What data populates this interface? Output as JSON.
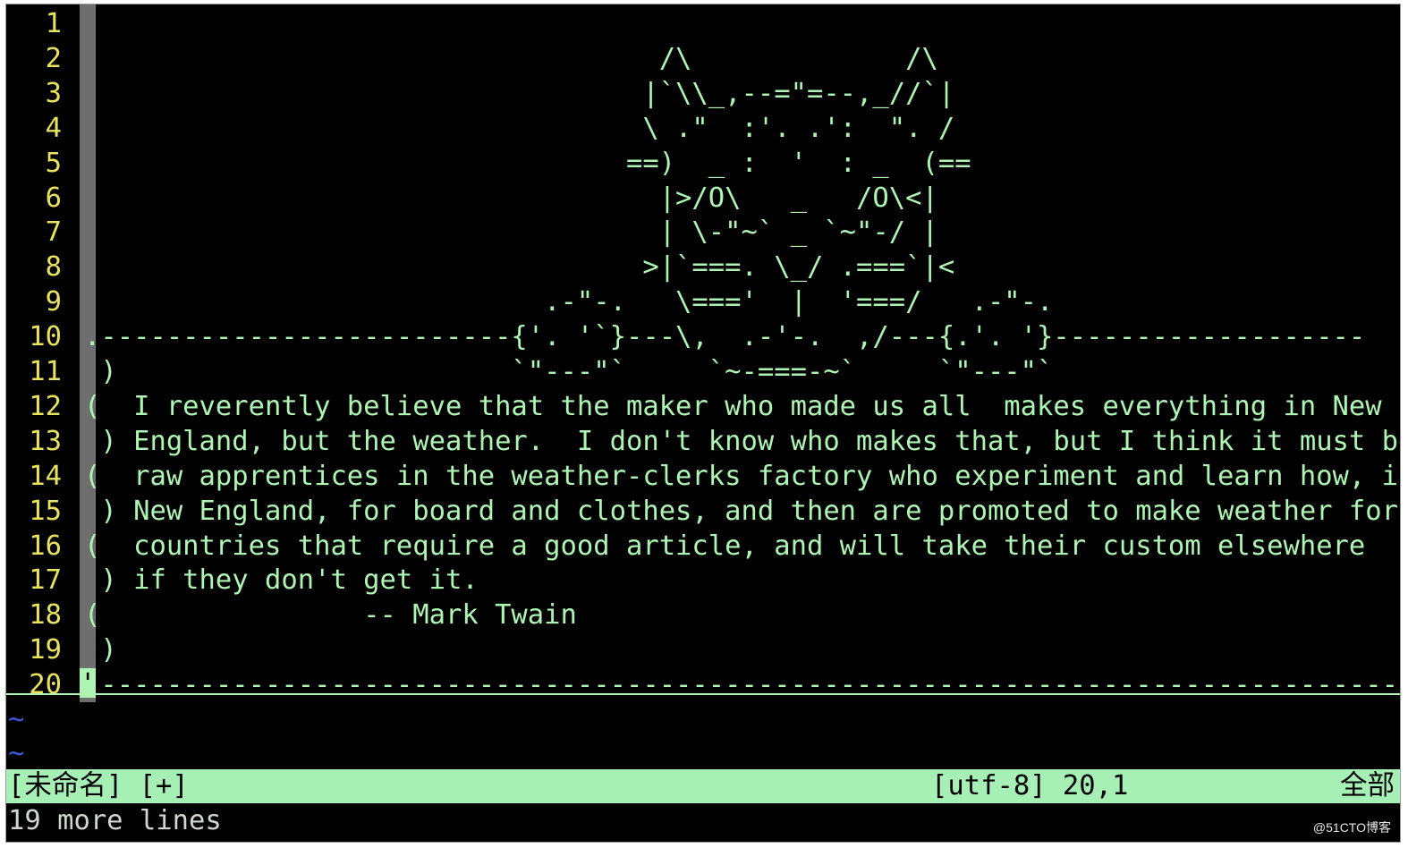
{
  "editor": {
    "lines": [
      {
        "num": "1",
        "text": ""
      },
      {
        "num": "2",
        "text": "                                   /\\             /\\"
      },
      {
        "num": "3",
        "text": "                                  |`\\\\_,--=\"=--,_//`|"
      },
      {
        "num": "4",
        "text": "                                  \\ .\"  :'. .':  \". /"
      },
      {
        "num": "5",
        "text": "                                 ==)  _ :  '  : _  (=="
      },
      {
        "num": "6",
        "text": "                                   |>/O\\   _   /O\\<|"
      },
      {
        "num": "7",
        "text": "                                   | \\-\"~` _ `~\"-/ |"
      },
      {
        "num": "8",
        "text": "                                  >|`===. \\_/ .===`|<"
      },
      {
        "num": "9",
        "text": "                            .-\"-.   \\==='  |  '===/   .-\"-."
      },
      {
        "num": "10",
        "text": ".-------------------------{'. '`}---\\,  .-'-.  ,/---{.'. '}-------------------"
      },
      {
        "num": "11",
        "text": " )                        `\"---\"`     `~-===-~`     `\"---\"`"
      },
      {
        "num": "12",
        "text": "(  I reverently believe that the maker who made us all  makes everything in New"
      },
      {
        "num": "13",
        "text": " ) England, but the weather.  I don't know who makes that, but I think it must be"
      },
      {
        "num": "14",
        "text": "(  raw apprentices in the weather-clerks factory who experiment and learn how, in"
      },
      {
        "num": "15",
        "text": " ) New England, for board and clothes, and then are promoted to make weather for"
      },
      {
        "num": "16",
        "text": "(  countries that require a good article, and will take their custom elsewhere"
      },
      {
        "num": "17",
        "text": " ) if they don't get it."
      },
      {
        "num": "18",
        "text": "(                -- Mark Twain"
      },
      {
        "num": "19",
        "text": " )"
      },
      {
        "num": "20",
        "text": " -------------------------------------------------------------------------------"
      }
    ],
    "cursor_char": "'",
    "empty_line_markers": [
      "~",
      "~"
    ]
  },
  "statusline": {
    "filename": "[未命名] [+]",
    "position": "[utf-8] 20,1",
    "scroll": "全部"
  },
  "message": "19 more lines",
  "watermark": "@51CTO博客",
  "colors": {
    "background": "#000000",
    "line_number": "#e8e35a",
    "text": "#aef5b4",
    "statusline_bg": "#a6f0b6",
    "tilde": "#3a5bd9"
  }
}
